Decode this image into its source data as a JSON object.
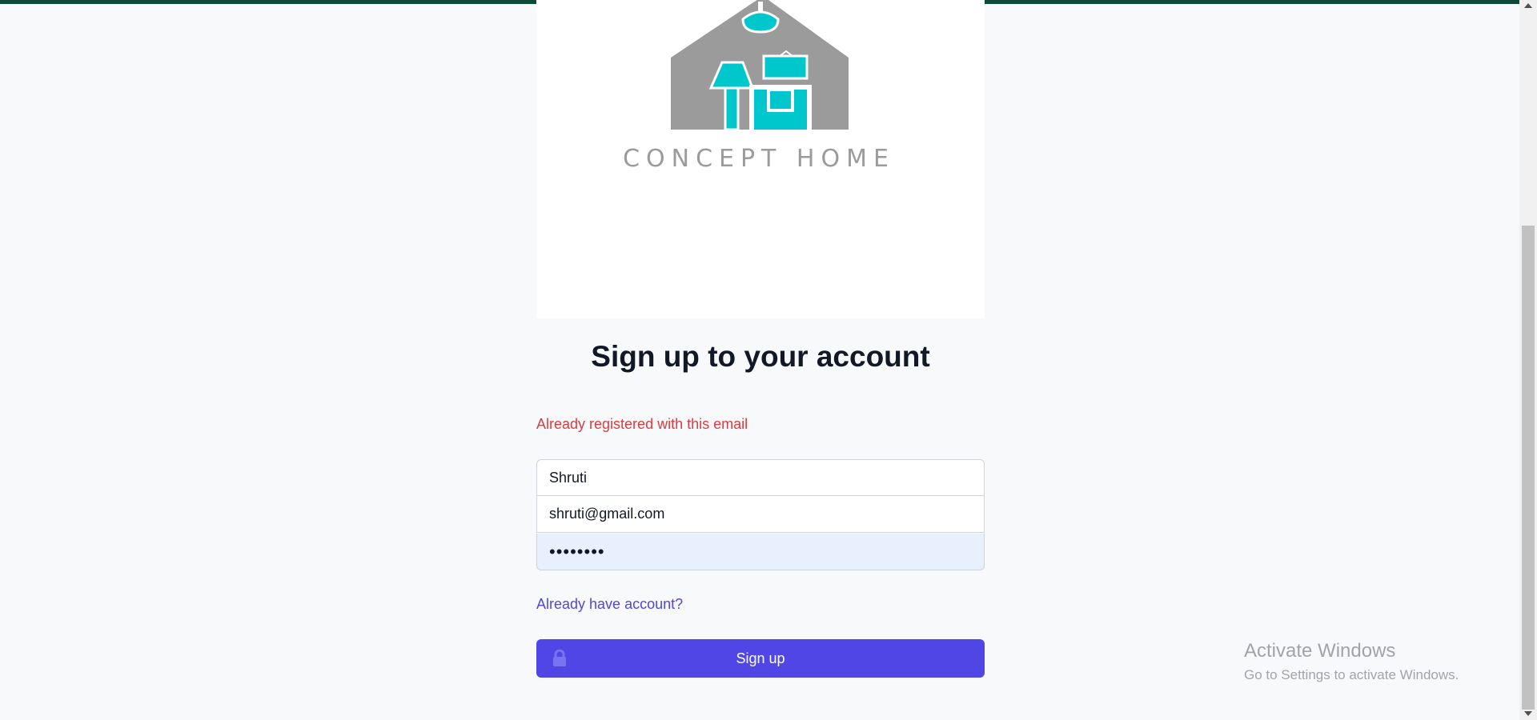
{
  "logo": {
    "brand_text": "CONCEPT HOME",
    "colors": {
      "house": "#9b9b9b",
      "accent": "#00c7cc",
      "text": "#9b9b9b"
    }
  },
  "form": {
    "title": "Sign up to your account",
    "error": "Already registered with this email",
    "name_value": "Shruti",
    "email_value": "shruti@gmail.com",
    "password_value": "••••••••",
    "login_link": "Already have account?",
    "submit_label": "Sign up"
  },
  "windows_watermark": {
    "title": "Activate Windows",
    "subtitle": "Go to Settings to activate Windows."
  },
  "colors": {
    "primary": "#4f46e5",
    "error": "#e0393e",
    "topbar": "#0e4a3a"
  }
}
